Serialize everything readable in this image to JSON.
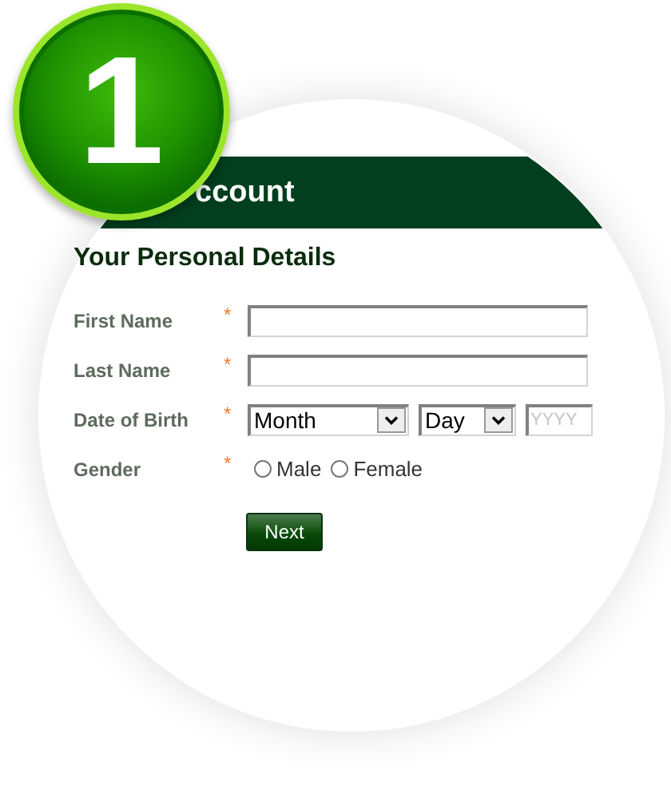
{
  "badge": {
    "number": "1"
  },
  "header": {
    "title": "ccount"
  },
  "section_title": "Your Personal Details",
  "fields": [
    {
      "kind": "text",
      "label": "First Name",
      "required": true,
      "required_mark": "*"
    },
    {
      "kind": "text",
      "label": "Last Name",
      "required": true,
      "required_mark": "*"
    },
    {
      "kind": "date",
      "label": "Date of Birth",
      "required": true,
      "required_mark": "*",
      "month": "Month",
      "day": "Day",
      "year_placeholder": "YYYY"
    },
    {
      "kind": "radio",
      "label": "Gender",
      "required": true,
      "required_mark": "*",
      "options": [
        {
          "label": "Male",
          "selected": false
        },
        {
          "label": "Female",
          "selected": false
        }
      ]
    }
  ],
  "buttons": [
    "Next"
  ]
}
